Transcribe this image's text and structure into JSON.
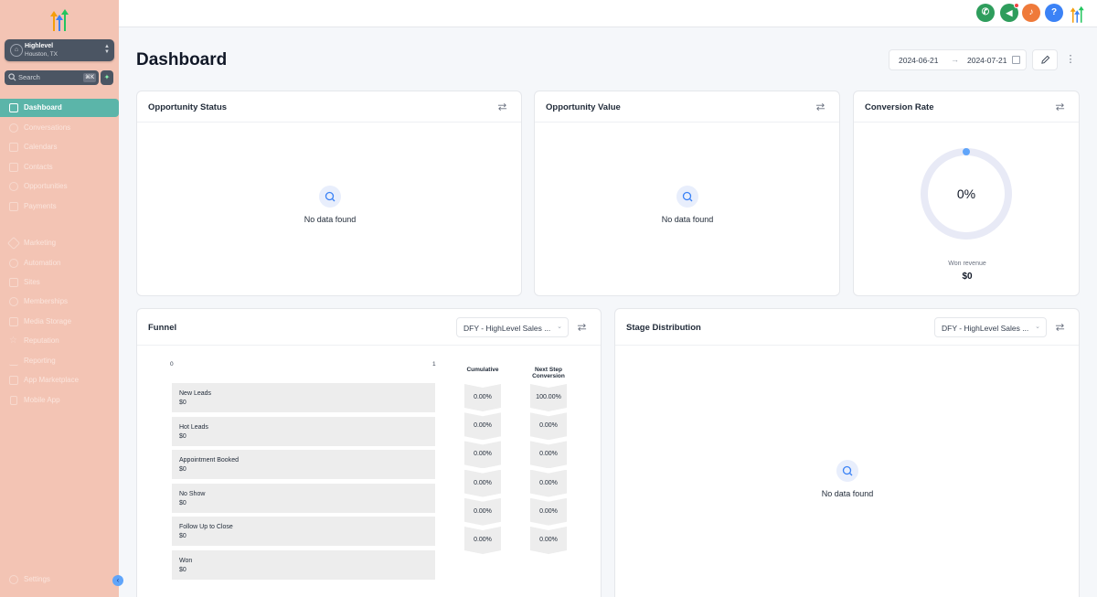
{
  "sidebar": {
    "location": {
      "name": "Highlevel",
      "city": "Houston, TX"
    },
    "search": {
      "placeholder": "Search",
      "shortcut": "⌘K"
    },
    "items": [
      {
        "label": "Dashboard",
        "icon": "grid-icon",
        "active": true
      },
      {
        "label": "Conversations",
        "icon": "chat-icon"
      },
      {
        "label": "Calendars",
        "icon": "calendar-icon"
      },
      {
        "label": "Contacts",
        "icon": "contacts-icon"
      },
      {
        "label": "Opportunities",
        "icon": "opportunities-icon"
      },
      {
        "label": "Payments",
        "icon": "payments-icon"
      },
      {
        "label": "Marketing",
        "icon": "send-icon"
      },
      {
        "label": "Automation",
        "icon": "automation-icon"
      },
      {
        "label": "Sites",
        "icon": "sites-icon"
      },
      {
        "label": "Memberships",
        "icon": "memberships-icon"
      },
      {
        "label": "Media Storage",
        "icon": "media-icon"
      },
      {
        "label": "Reputation",
        "icon": "star-icon"
      },
      {
        "label": "Reporting",
        "icon": "trend-icon"
      },
      {
        "label": "App Marketplace",
        "icon": "apps-icon"
      },
      {
        "label": "Mobile App",
        "icon": "mobile-icon"
      }
    ],
    "settings_label": "Settings"
  },
  "topbar": {
    "icons": [
      {
        "name": "phone-icon",
        "glyph": "✆",
        "color": "#2e9d5c"
      },
      {
        "name": "megaphone-icon",
        "glyph": "📢",
        "color": "#2e9d5c"
      },
      {
        "name": "bell-icon",
        "glyph": "🔔",
        "color": "#ef7a3a"
      },
      {
        "name": "help-icon",
        "glyph": "?",
        "color": "#3b82f6"
      }
    ]
  },
  "header": {
    "title": "Dashboard",
    "date_from": "2024-06-21",
    "date_to": "2024-07-21"
  },
  "cards": {
    "opportunity_status": {
      "title": "Opportunity Status",
      "empty": "No data found"
    },
    "opportunity_value": {
      "title": "Opportunity Value",
      "empty": "No data found"
    },
    "conversion_rate": {
      "title": "Conversion Rate",
      "value": "0%",
      "won_label": "Won revenue",
      "won_value": "$0"
    },
    "funnel": {
      "title": "Funnel",
      "pipeline": "DFY - HighLevel Sales ...",
      "axis_start": "0",
      "axis_end": "1",
      "col_cumulative": "Cumulative",
      "col_next": "Next Step Conversion",
      "stages": [
        {
          "name": "New Leads",
          "value": "$0"
        },
        {
          "name": "Hot Leads",
          "value": "$0"
        },
        {
          "name": "Appointment Booked",
          "value": "$0"
        },
        {
          "name": "No Show",
          "value": "$0"
        },
        {
          "name": "Follow Up to Close",
          "value": "$0"
        },
        {
          "name": "Won",
          "value": "$0"
        }
      ],
      "cumulative": [
        "0.00%",
        "0.00%",
        "0.00%",
        "0.00%",
        "0.00%",
        "0.00%"
      ],
      "next_step": [
        "100.00%",
        "0.00%",
        "0.00%",
        "0.00%",
        "0.00%",
        "0.00%"
      ]
    },
    "stage_distribution": {
      "title": "Stage Distribution",
      "pipeline": "DFY - HighLevel Sales ...",
      "empty": "No data found"
    }
  }
}
